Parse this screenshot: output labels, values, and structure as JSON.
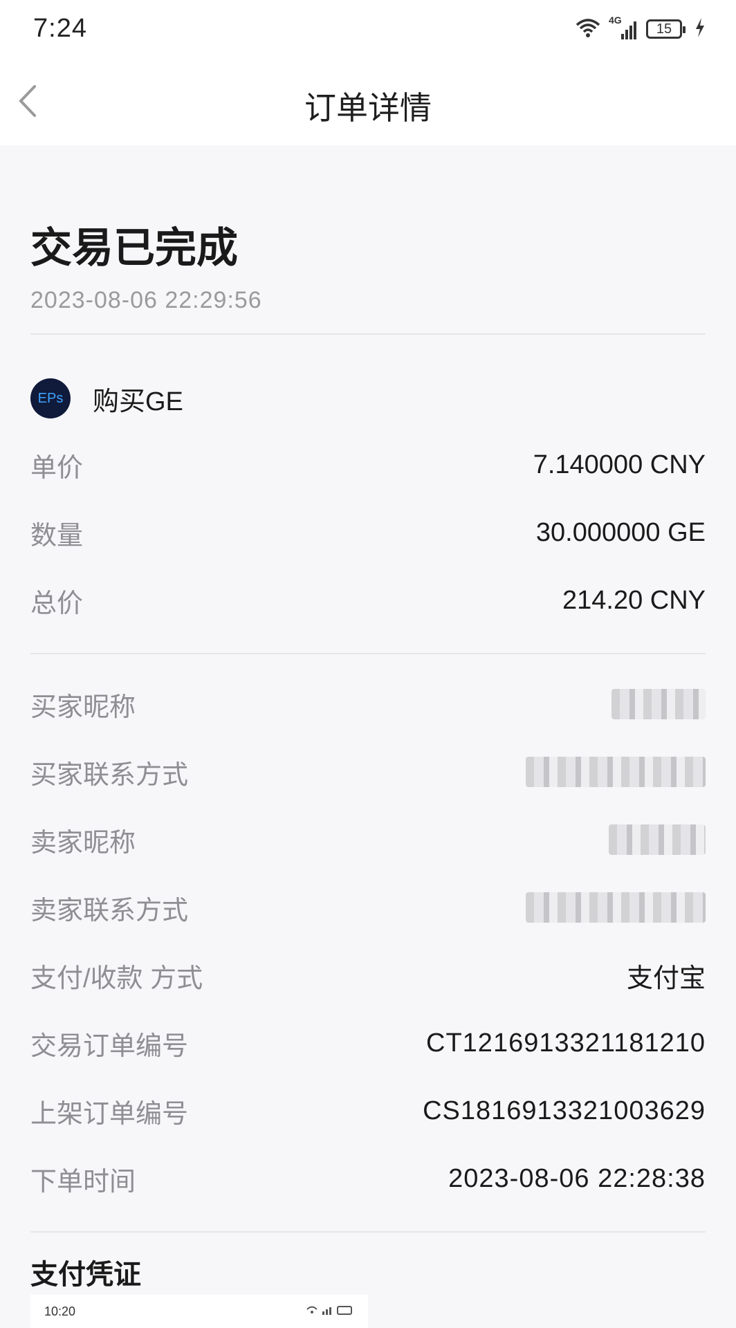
{
  "status_bar": {
    "time": "7:24",
    "network": "4G",
    "battery": "15",
    "icons": [
      "wifi-icon",
      "signal-icon",
      "battery-icon",
      "charging-icon"
    ]
  },
  "nav": {
    "title": "订单详情",
    "back_icon": "chevron-left-icon"
  },
  "order": {
    "status": "交易已完成",
    "completed_time": "2023-08-06 22:29:56",
    "product": {
      "logo_text": "EPs",
      "name": "购买GE"
    },
    "price_rows": [
      {
        "label": "单价",
        "value": "7.140000 CNY"
      },
      {
        "label": "数量",
        "value": "30.000000 GE"
      },
      {
        "label": "总价",
        "value": "214.20 CNY"
      }
    ],
    "detail_rows": [
      {
        "label": "买家昵称",
        "value": "",
        "obscured": true
      },
      {
        "label": "买家联系方式",
        "value": "",
        "obscured": true
      },
      {
        "label": "卖家昵称",
        "value": "",
        "obscured": true
      },
      {
        "label": "卖家联系方式",
        "value": "",
        "obscured": true
      },
      {
        "label": "支付/收款 方式",
        "value": "支付宝"
      },
      {
        "label": "交易订单编号",
        "value": "CT1216913321181210"
      },
      {
        "label": "上架订单编号",
        "value": "CS1816913321003629"
      },
      {
        "label": "下单时间",
        "value": "2023-08-06 22:28:38"
      }
    ],
    "payment_proof": {
      "title": "支付凭证",
      "thumbnail_time": "10:20"
    }
  },
  "colors": {
    "page_bg": "#f7f7f9",
    "header_bg": "#ffffff",
    "label": "#8e8e93",
    "value": "#1a1a1a",
    "logo_bg": "#101a3a",
    "logo_fg": "#3ea4ff"
  }
}
